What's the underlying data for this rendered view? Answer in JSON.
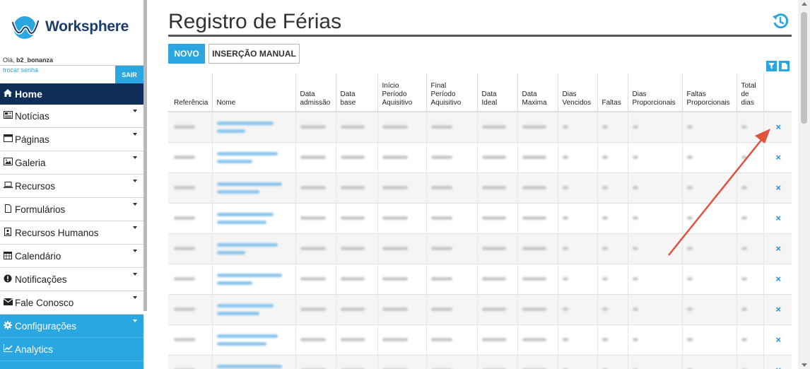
{
  "brand": {
    "name": "Worksphere"
  },
  "user": {
    "greeting": "Olá, ",
    "username": "b2_bonanza",
    "change_password": "trocar senha",
    "logout": "SAIR"
  },
  "sidebar": {
    "home": "Home",
    "items": [
      {
        "label": "Notícias",
        "icon": "newspaper-icon"
      },
      {
        "label": "Páginas",
        "icon": "window-icon"
      },
      {
        "label": "Galeria",
        "icon": "image-icon"
      },
      {
        "label": "Recursos",
        "icon": "laptop-icon"
      },
      {
        "label": "Formulários",
        "icon": "file-icon"
      },
      {
        "label": "Recursos Humanos",
        "icon": "id-badge-icon"
      },
      {
        "label": "Calendário",
        "icon": "calendar-icon"
      },
      {
        "label": "Notificações",
        "icon": "exclamation-icon"
      },
      {
        "label": "Fale Conosco",
        "icon": "envelope-icon"
      }
    ],
    "config": "Configurações",
    "analytics": "Analytics"
  },
  "page": {
    "title": "Registro de Férias"
  },
  "toolbar": {
    "new_label": "NOVO",
    "manual_label": "INSERÇÃO MANUAL",
    "filter_icon": "filter-icon",
    "export_icon": "document-icon"
  },
  "table": {
    "headers": [
      [
        "Referência"
      ],
      [
        "Nome"
      ],
      [
        "Data",
        "admissão"
      ],
      [
        "Data",
        "base"
      ],
      [
        "Início",
        "Período",
        "Aquisitivo"
      ],
      [
        "Final",
        "Período",
        "Aquisitivo"
      ],
      [
        "Data",
        "Ideal"
      ],
      [
        "Data",
        "Maxima"
      ],
      [
        "Dias",
        "Vencidos"
      ],
      [
        "Faltas"
      ],
      [
        "Dias",
        "Proporcionais"
      ],
      [
        "Faltas",
        "Proporcionais"
      ],
      [
        "Total",
        "de",
        "dias"
      ]
    ],
    "row_count": 9,
    "delete_symbol": "×"
  }
}
